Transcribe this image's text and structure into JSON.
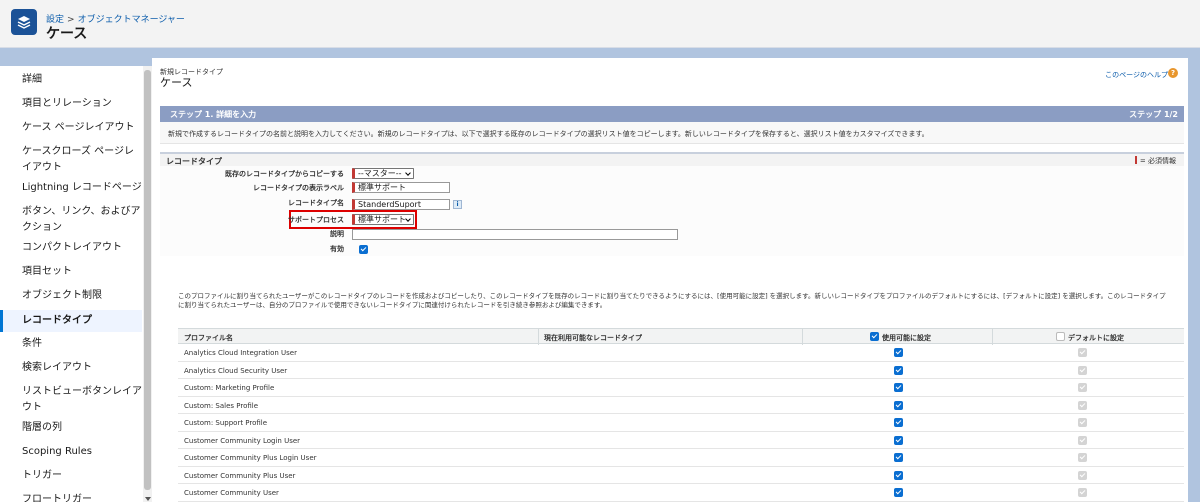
{
  "header": {
    "breadcrumb_setup": "設定",
    "breadcrumb_sep": ">",
    "breadcrumb_object_manager": "オブジェクトマネージャー",
    "title": "ケース",
    "app_icon": "layers-icon"
  },
  "sidebar": {
    "items": [
      {
        "label": "詳細"
      },
      {
        "label": "項目とリレーション"
      },
      {
        "label": "ケース ページレイアウト"
      },
      {
        "label": "ケースクローズ ページレイアウト"
      },
      {
        "label": "Lightning レコードページ"
      },
      {
        "label": "ボタン、リンク、およびアクション"
      },
      {
        "label": "コンパクトレイアウト"
      },
      {
        "label": "項目セット"
      },
      {
        "label": "オブジェクト制限"
      },
      {
        "label": "レコードタイプ"
      },
      {
        "label": "条件"
      },
      {
        "label": "検索レイアウト"
      },
      {
        "label": "リストビューボタンレイアウト"
      },
      {
        "label": "階層の列"
      },
      {
        "label": "Scoping Rules"
      },
      {
        "label": "トリガー"
      },
      {
        "label": "フロートリガー"
      }
    ],
    "active_index": 9
  },
  "main": {
    "page_label": "新規レコードタイプ",
    "page_title": "ケース",
    "help_link": "このページのヘルプ",
    "help_icon": "question-icon",
    "step_label": "ステップ 1. 詳細を入力",
    "step_count": "ステップ 1/2",
    "description": "新規で作成するレコードタイプの名前と説明を入力してください。新規のレコードタイプは、以下で選択する既存のレコードタイプの選択リスト値をコピーします。新しいレコードタイプを保存すると、選択リスト値をカスタマイズできます。",
    "section_title": "レコードタイプ",
    "required_info": "= 必須情報"
  },
  "form": {
    "copy_from_label": "既存のレコードタイプからコピーする",
    "copy_from_value": "--マスター--",
    "display_label_label": "レコードタイプの表示ラベル",
    "display_label_value": "標準サポート",
    "name_label": "レコードタイプ名",
    "name_value": "StanderdSuport",
    "info_icon": "i",
    "support_process_label": "サポートプロセス",
    "support_process_value": "標準サポート",
    "description_label": "説明",
    "description_value": "",
    "active_label": "有効",
    "active_checked": true
  },
  "note": "このプロファイルに割り当てられたユーザーがこのレコードタイプのレコードを作成およびコピーしたり、このレコードタイプを既存のレコードに割り当てたりできるようにするには、[使用可能に設定] を選択します。新しいレコードタイプをプロファイルのデフォルトにするには、[デフォルトに設定] を選択します。このレコードタイプに割り当てられたユーザーは、自分のプロファイルで使用できないレコードタイプに関連付けられたレコードを引き続き参照および編集できます。",
  "table": {
    "col_profile": "プロファイル名",
    "col_current": "現在利用可能なレコードタイプ",
    "col_enable": "使用可能に設定",
    "col_default": "デフォルトに設定",
    "rows": [
      {
        "name": "Analytics Cloud Integration User"
      },
      {
        "name": "Analytics Cloud Security User"
      },
      {
        "name": "Custom: Marketing Profile"
      },
      {
        "name": "Custom: Sales Profile"
      },
      {
        "name": "Custom: Support Profile"
      },
      {
        "name": "Customer Community Login User"
      },
      {
        "name": "Customer Community Plus Login User"
      },
      {
        "name": "Customer Community Plus User"
      },
      {
        "name": "Customer Community User"
      }
    ]
  },
  "colors": {
    "accent": "#0176d3",
    "step_bar": "#8b9dc3",
    "required": "#c23934",
    "highlight": "#dd0000"
  }
}
